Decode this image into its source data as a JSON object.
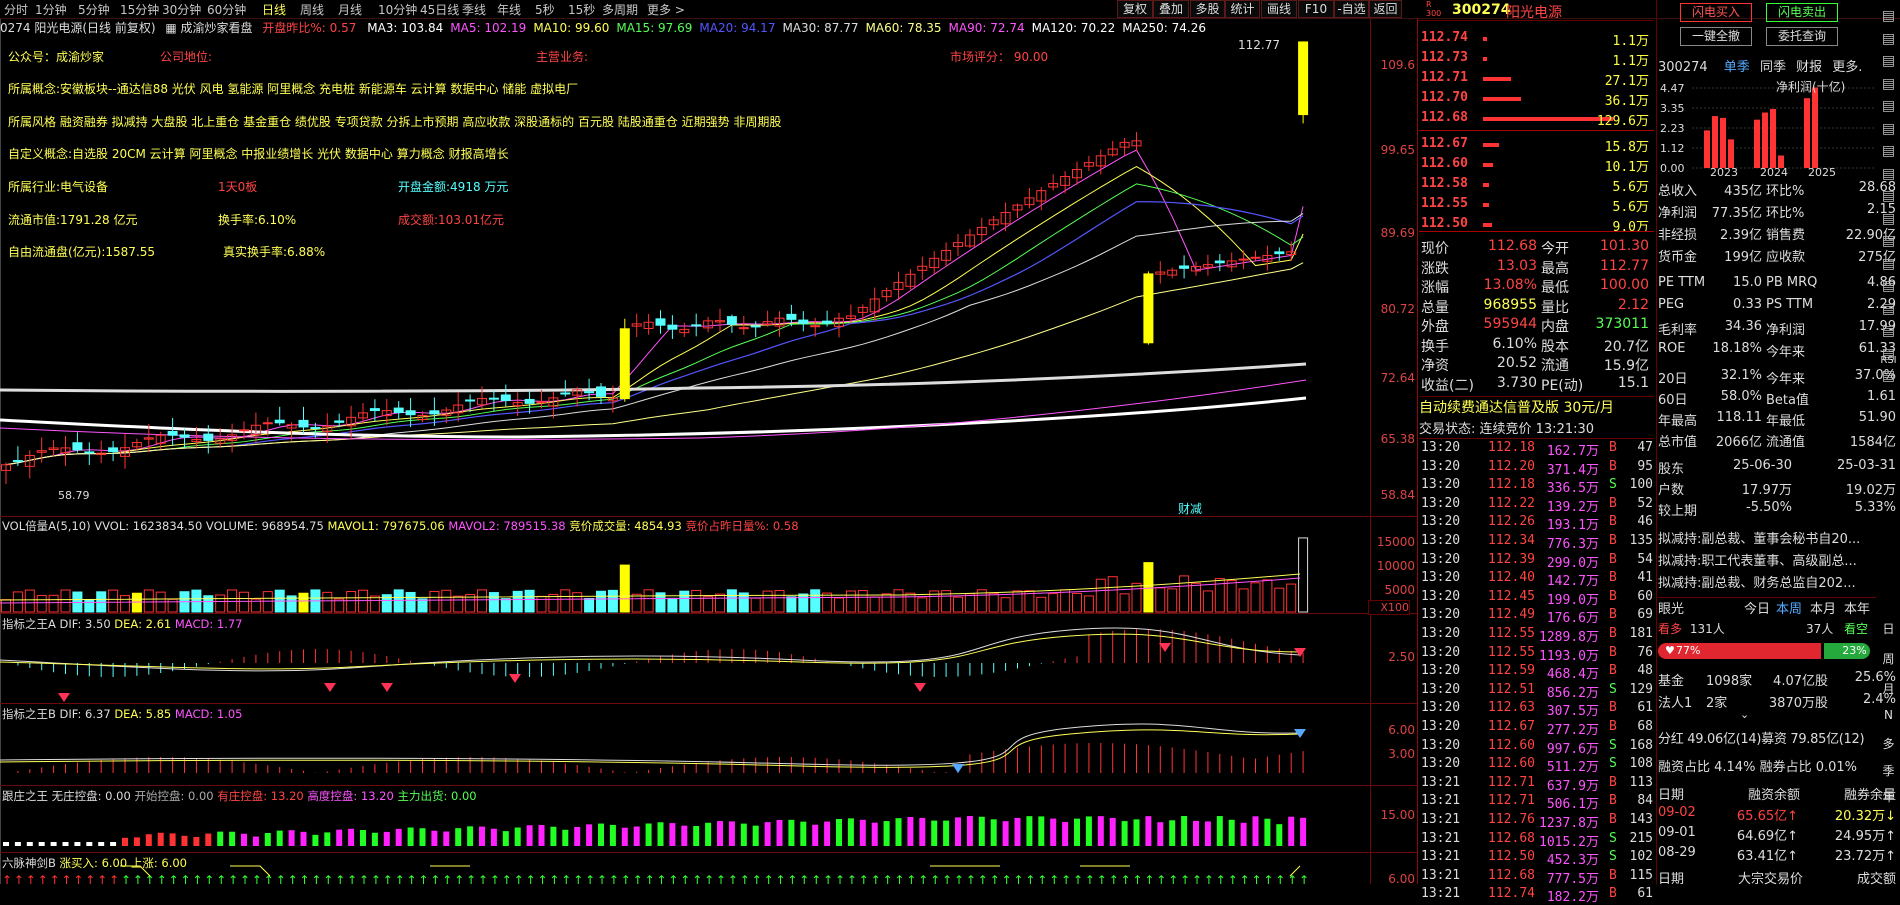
{
  "period_tabs": [
    "分时",
    "1分钟",
    "5分钟",
    "15分钟",
    "30分钟",
    "60分钟",
    "日线",
    "周线",
    "月线",
    "10分钟",
    "45日线",
    "季线",
    "年线",
    "5秒",
    "15秒",
    "多周期",
    "更多 >"
  ],
  "top_right_buttons": [
    "复权",
    "叠加",
    "多股",
    "统计",
    "画线",
    "F10",
    "-自选",
    "返回"
  ],
  "header": {
    "code_name": "0274 阳光电源(日线 前复权)",
    "plugin": "成渝炒家看盘",
    "open_diff_label": "开盘昨比%:",
    "open_diff_value": "0.57",
    "ma": [
      {
        "label": "MA3: 103.84",
        "color": "#ffffff"
      },
      {
        "label": "MA5: 102.19",
        "color": "#ff55ff"
      },
      {
        "label": "MA10: 99.60",
        "color": "#ffff55"
      },
      {
        "label": "MA15: 97.69",
        "color": "#55ff55"
      },
      {
        "label": "MA20: 94.17",
        "color": "#5555ff"
      },
      {
        "label": "MA30: 87.77",
        "color": "#dddddd"
      },
      {
        "label": "MA60: 78.35",
        "color": "#ffff88"
      },
      {
        "label": "MA90: 72.74",
        "color": "#ff55ff"
      },
      {
        "label": "MA120: 70.22",
        "color": "#ffffff"
      },
      {
        "label": "MA250: 74.26",
        "color": "#ffffff"
      }
    ]
  },
  "info": {
    "gzh": "公众号：成渝炒家",
    "company_pos": "公司地位:",
    "main_biz": "主营业务:",
    "market_score": "市场评分： 90.00",
    "concept": "所属概念:安徽板块--通达信88 光伏 风电 氢能源 阿里概念 充电桩 新能源车 云计算 数据中心 储能 虚拟电厂",
    "style": "所属风格 融资融券 拟减持 大盘股 北上重仓 基金重仓 绩优股 专项贷款 分拆上市预期 高应收款 深股通标的 百元股 陆股通重仓 近期强势 非周期股",
    "custom": "自定义概念:自选股 20CM 云计算 阿里概念 中报业绩增长 光伏 数据中心 算力概念 财报高增长",
    "industry": "所属行业:电气设备",
    "board": "1天0板",
    "open_amount": "开盘金额:4918 万元",
    "float_cap": "流通市值:1791.28 亿元",
    "turnover": "换手率:6.10%",
    "volume_amt": "成交额:103.01亿元",
    "free_float": "自由流通盘(亿元):1587.55",
    "real_turnover": "真实换手率:6.88%"
  },
  "y_axis": [
    "109.6",
    "99.65",
    "89.69",
    "80.72",
    "72.64",
    "65.38",
    "58.84"
  ],
  "high_label": "112.77",
  "low_label": "58.79",
  "event_tag": "财减",
  "vol_header": {
    "name": "VOL倍量A(5,10)",
    "vvol": "VVOL: 1623834.50",
    "volume": "VOLUME: 968954.75",
    "mavol1": "MAVOL1: 797675.06",
    "mavol2": "MAVOL2: 789515.38",
    "bid_vol": "竞价成交量: 4854.93",
    "bid_ratio": "竞价占昨日量%: 0.58"
  },
  "vol_axis": [
    "15000",
    "10000",
    "5000",
    "X100"
  ],
  "macd_a": {
    "name": "指标之王A",
    "dif": "DIF: 3.50",
    "dea": "DEA: 2.61",
    "macd": "MACD: 1.77",
    "axis": "2.50"
  },
  "macd_b": {
    "name": "指标之王B",
    "dif": "DIF: 6.37",
    "dea": "DEA: 5.85",
    "macd": "MACD: 1.05",
    "axis1": "6.00",
    "axis2": "3.00"
  },
  "zhuang": {
    "name": "跟庄之王",
    "none": "无庄控盘: 0.00",
    "start": "开始控盘: 0.00",
    "has": "有庄控盘: 13.20",
    "high": "高度控盘: 13.20",
    "out": "主力出货: 0.00",
    "axis": "15.00"
  },
  "liumai": {
    "name": "六脉神剑B",
    "buy": "涨买入: 6.00",
    "up": "上涨: 6.00",
    "axis": "6.00"
  },
  "stock": {
    "code": "300274",
    "name": "阳光电源",
    "badge": "R 300"
  },
  "trade_buttons": {
    "flash_buy": "闪电买入",
    "flash_sell": "闪电卖出",
    "one_key": "一键全撤",
    "commission": "委托查询"
  },
  "order_book": {
    "asks": [
      {
        "p": "112.74",
        "v": "1.1万",
        "w": 4
      },
      {
        "p": "112.73",
        "v": "1.1万",
        "w": 4
      },
      {
        "p": "112.71",
        "v": "27.1万",
        "w": 28
      },
      {
        "p": "112.70",
        "v": "36.1万",
        "w": 38
      },
      {
        "p": "112.68",
        "v": "129.6万",
        "w": 130
      }
    ],
    "bids": [
      {
        "p": "112.67",
        "v": "15.8万",
        "w": 16
      },
      {
        "p": "112.60",
        "v": "10.1万",
        "w": 10
      },
      {
        "p": "112.58",
        "v": "5.6万",
        "w": 6
      },
      {
        "p": "112.55",
        "v": "5.6万",
        "w": 6
      },
      {
        "p": "112.50",
        "v": "9.0万",
        "w": 9
      }
    ]
  },
  "quotes": [
    [
      "现价",
      "112.68",
      "今开",
      "101.30"
    ],
    [
      "涨跌",
      "13.03",
      "最高",
      "112.77"
    ],
    [
      "涨幅",
      "13.08%",
      "最低",
      "100.00"
    ],
    [
      "总量",
      "968955",
      "量比",
      "2.12"
    ],
    [
      "外盘",
      "595944",
      "内盘",
      "373011"
    ],
    [
      "换手",
      "6.10%",
      "股本",
      "20.7亿"
    ],
    [
      "净资",
      "20.52",
      "流通",
      "15.9亿"
    ],
    [
      "收益(二)",
      "3.730",
      "PE(动)",
      "15.1"
    ]
  ],
  "promo": "自动续费通达信普及版  30元/月",
  "trade_status": "交易状态: 连续竞价  13:21:30",
  "ticks": [
    [
      "13:20",
      "112.18",
      "162.7万",
      "B",
      "47"
    ],
    [
      "13:20",
      "112.20",
      "371.4万",
      "B",
      "95"
    ],
    [
      "13:20",
      "112.18",
      "336.5万",
      "S",
      "100"
    ],
    [
      "13:20",
      "112.22",
      "139.2万",
      "B",
      "52"
    ],
    [
      "13:20",
      "112.26",
      "193.1万",
      "B",
      "46"
    ],
    [
      "13:20",
      "112.34",
      "776.3万",
      "B",
      "135"
    ],
    [
      "13:20",
      "112.39",
      "299.0万",
      "B",
      "54"
    ],
    [
      "13:20",
      "112.40",
      "142.7万",
      "B",
      "41"
    ],
    [
      "13:20",
      "112.45",
      "199.0万",
      "B",
      "60"
    ],
    [
      "13:20",
      "112.49",
      "176.6万",
      "B",
      "69"
    ],
    [
      "13:20",
      "112.55",
      "1289.8万",
      "B",
      "181"
    ],
    [
      "13:20",
      "112.55",
      "1193.0万",
      "B",
      "76"
    ],
    [
      "13:20",
      "112.59",
      "468.4万",
      "B",
      "48"
    ],
    [
      "13:20",
      "112.51",
      "856.2万",
      "S",
      "129"
    ],
    [
      "13:20",
      "112.63",
      "307.5万",
      "B",
      "61"
    ],
    [
      "13:20",
      "112.67",
      "277.2万",
      "B",
      "68"
    ],
    [
      "13:20",
      "112.60",
      "997.6万",
      "S",
      "168"
    ],
    [
      "13:20",
      "112.60",
      "511.2万",
      "S",
      "108"
    ],
    [
      "13:21",
      "112.71",
      "637.9万",
      "B",
      "113"
    ],
    [
      "13:21",
      "112.71",
      "506.1万",
      "B",
      "84"
    ],
    [
      "13:21",
      "112.76",
      "1237.8万",
      "B",
      "143"
    ],
    [
      "13:21",
      "112.68",
      "1015.2万",
      "S",
      "215"
    ],
    [
      "13:21",
      "112.50",
      "452.3万",
      "S",
      "102"
    ],
    [
      "13:21",
      "112.68",
      "777.5万",
      "B",
      "115"
    ],
    [
      "13:21",
      "112.74",
      "182.2万",
      "B",
      "61"
    ]
  ],
  "fin_tabs": {
    "code": "300274",
    "t1": "单季",
    "t2": "同季",
    "t3": "财报",
    "t4": "更多."
  },
  "fin_chart": {
    "title": "净利润(十亿)",
    "yticks": [
      "4.47",
      "3.35",
      "2.23",
      "1.12",
      "0.00"
    ],
    "years": [
      "2023",
      "2024",
      "2025"
    ],
    "values": [
      2.1,
      2.9,
      2.8,
      1.6,
      2.7,
      3.1,
      3.3,
      0.7,
      3.9,
      4.5
    ]
  },
  "fundamentals": [
    [
      "总收入",
      "435亿",
      "环比%",
      "28.68"
    ],
    [
      "净利润",
      "77.35亿",
      "环比%",
      "2.15"
    ],
    [
      "非经损",
      "2.39亿",
      "销售费",
      "22.90亿"
    ],
    [
      "货币金",
      "199亿",
      "应收款",
      "275亿"
    ],
    [
      "PE TTM",
      "15.0",
      "PB MRQ",
      "4.86"
    ],
    [
      "PEG",
      "0.33",
      "PS TTM",
      "2.29"
    ],
    [
      "毛利率",
      "34.36",
      "净利润",
      "17.99"
    ],
    [
      "ROE",
      "18.18%",
      "今年来",
      "61.33"
    ],
    [
      "20日",
      "32.1%",
      "今年来",
      "37.0%"
    ],
    [
      "60日",
      "58.0%",
      "Beta值",
      "1.61"
    ],
    [
      "年最高",
      "118.11",
      "年最低",
      "51.90"
    ],
    [
      "总市值",
      "2066亿",
      "流通值",
      "1584亿"
    ]
  ],
  "holders": {
    "h1": "股东",
    "d1": "25-06-30",
    "d2": "25-03-31",
    "h2": "户数",
    "v1": "17.97万",
    "v2": "19.02万",
    "h3": "较上期",
    "c1": "-5.50%",
    "c2": "5.33%"
  },
  "notices": [
    "拟减持:副总裁、董事会秘书自20...",
    "拟减持:职工代表董事、高级副总...",
    "拟减持:副总裁、财务总监自202..."
  ],
  "eye": {
    "title": "眼光",
    "today": "今日",
    "week": "本周",
    "month": "本月",
    "year": "本年"
  },
  "sentiment": {
    "bull": "看多",
    "bull_n": "131人",
    "bear_n": "37人",
    "bear": "看空",
    "bull_pct": "77%",
    "bear_pct": "23%"
  },
  "funds": [
    [
      "基金",
      "1098家",
      "4.07亿股",
      "25.6%"
    ],
    [
      "法人1",
      "2家",
      "3870万股",
      "2.4%"
    ]
  ],
  "margin": {
    "split": "分红 49.06亿(14)募资 79.85亿(12)",
    "ratio": "融资占比  4.14%  融券占比  0.01%",
    "headers": [
      "日期",
      "融资余额",
      "融券余量"
    ],
    "rows": [
      [
        "09-02",
        "65.65亿↑",
        "20.32万↓"
      ],
      [
        "09-01",
        "64.69亿↑",
        "24.95万↑"
      ],
      [
        "08-29",
        "63.41亿↑",
        "23.72万↑"
      ]
    ],
    "next": [
      "日期",
      "大宗交易价",
      "成交额"
    ]
  },
  "side_icons": [
    "RSI",
    "日",
    "周",
    "月",
    "N",
    "多",
    "季",
    "年"
  ]
}
